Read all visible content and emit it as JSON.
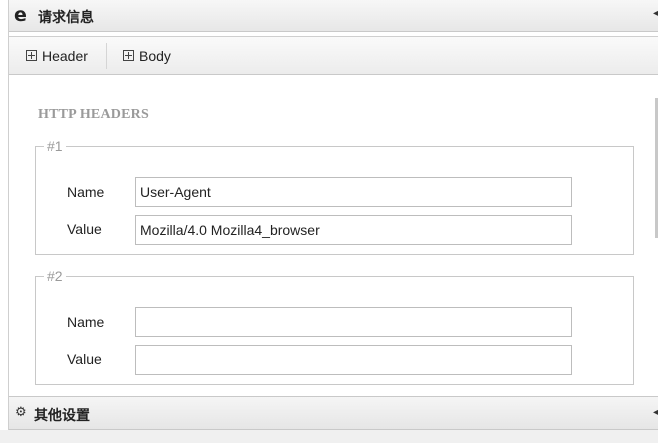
{
  "request_panel": {
    "icon": "ie-browser-icon",
    "icon_glyph": "e",
    "title": "请求信息",
    "collapse_glyph": "◂"
  },
  "tabs": [
    {
      "label": "Header",
      "icon": "expand-plus-icon"
    },
    {
      "label": "Body",
      "icon": "expand-plus-icon"
    }
  ],
  "headers_section": {
    "title": "HTTP HEADERS",
    "groups": [
      {
        "legend": "#1",
        "name_label": "Name",
        "name_value": "User-Agent",
        "value_label": "Value",
        "value_value": "Mozilla/4.0 Mozilla4_browser"
      },
      {
        "legend": "#2",
        "name_label": "Name",
        "name_value": "",
        "value_label": "Value",
        "value_value": ""
      }
    ]
  },
  "other_settings_panel": {
    "icon": "gears-icon",
    "icon_glyph": "⚙",
    "title": "其他设置",
    "collapse_glyph": "◂"
  }
}
